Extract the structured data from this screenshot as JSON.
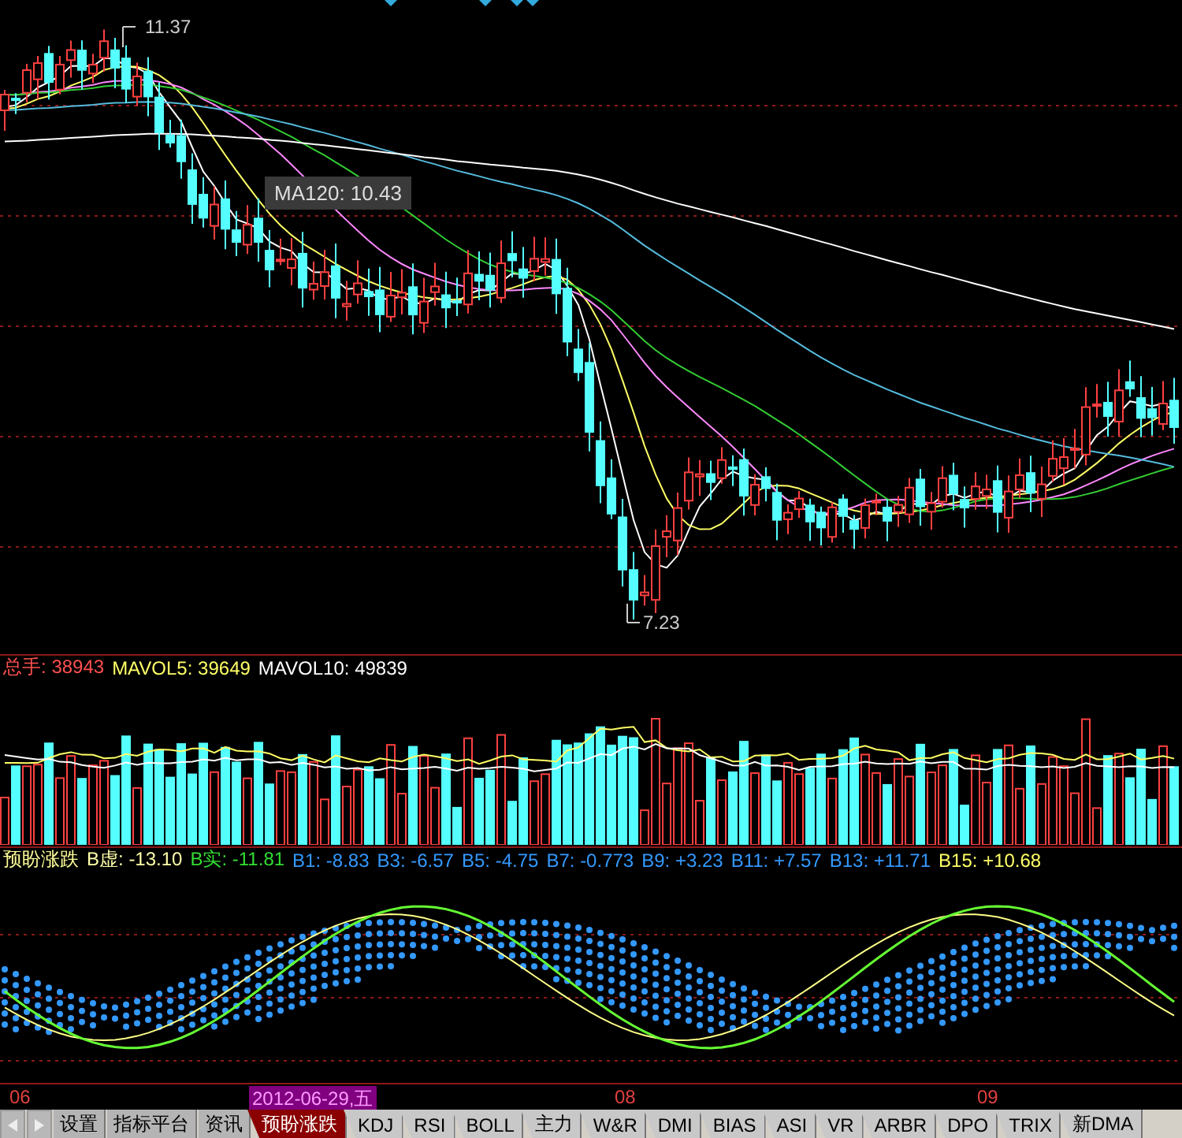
{
  "price_chart": {
    "high_label": "11.37",
    "low_label": "7.23",
    "tooltip": "MA120: 10.43"
  },
  "volume_legend": [
    {
      "label": "总手:",
      "value": "38943",
      "color": "#ff5050"
    },
    {
      "label": "MAVOL5:",
      "value": "39649",
      "color": "#ffff66"
    },
    {
      "label": "MAVOL10:",
      "value": "49839",
      "color": "#ffffff"
    }
  ],
  "indicator_legend": {
    "title": "预盼涨跌",
    "items": [
      {
        "label": "B虚:",
        "value": "-13.10",
        "color": "#ffffaa"
      },
      {
        "label": "B实:",
        "value": "-11.81",
        "color": "#33dd33"
      },
      {
        "label": "B1:",
        "value": "-8.83",
        "color": "#3399ff"
      },
      {
        "label": "B3:",
        "value": "-6.57",
        "color": "#3399ff"
      },
      {
        "label": "B5:",
        "value": "-4.75",
        "color": "#3399ff"
      },
      {
        "label": "B7:",
        "value": "-0.773",
        "color": "#3399ff"
      },
      {
        "label": "B9:",
        "value": "+3.23",
        "color": "#3399ff"
      },
      {
        "label": "B11:",
        "value": "+7.57",
        "color": "#3399ff"
      },
      {
        "label": "B13:",
        "value": "+11.71",
        "color": "#3399ff"
      },
      {
        "label": "B15:",
        "value": "+10.68",
        "color": "#ffff66"
      }
    ]
  },
  "date_axis": [
    {
      "label": "06",
      "kind": "tick"
    },
    {
      "label": "2012-06-29,五",
      "kind": "cursor"
    },
    {
      "label": "08",
      "kind": "tick"
    },
    {
      "label": "09",
      "kind": "tick"
    }
  ],
  "tabs": [
    {
      "label": "设置",
      "kind": "button",
      "selected": false
    },
    {
      "label": "指标平台",
      "kind": "button",
      "selected": false
    },
    {
      "label": "资讯",
      "kind": "button",
      "selected": false
    },
    {
      "label": "预盼涨跌",
      "kind": "tab",
      "selected": true
    },
    {
      "label": "KDJ",
      "kind": "tab",
      "selected": false
    },
    {
      "label": "RSI",
      "kind": "tab",
      "selected": false
    },
    {
      "label": "BOLL",
      "kind": "tab",
      "selected": false
    },
    {
      "label": "主力",
      "kind": "tab",
      "selected": false
    },
    {
      "label": "W&R",
      "kind": "tab",
      "selected": false
    },
    {
      "label": "DMI",
      "kind": "tab",
      "selected": false
    },
    {
      "label": "BIAS",
      "kind": "tab",
      "selected": false
    },
    {
      "label": "ASI",
      "kind": "tab",
      "selected": false
    },
    {
      "label": "VR",
      "kind": "tab",
      "selected": false
    },
    {
      "label": "ARBR",
      "kind": "tab",
      "selected": false
    },
    {
      "label": "DPO",
      "kind": "tab",
      "selected": false
    },
    {
      "label": "TRIX",
      "kind": "tab",
      "selected": false
    },
    {
      "label": "新DMA",
      "kind": "tab",
      "selected": false
    }
  ]
}
